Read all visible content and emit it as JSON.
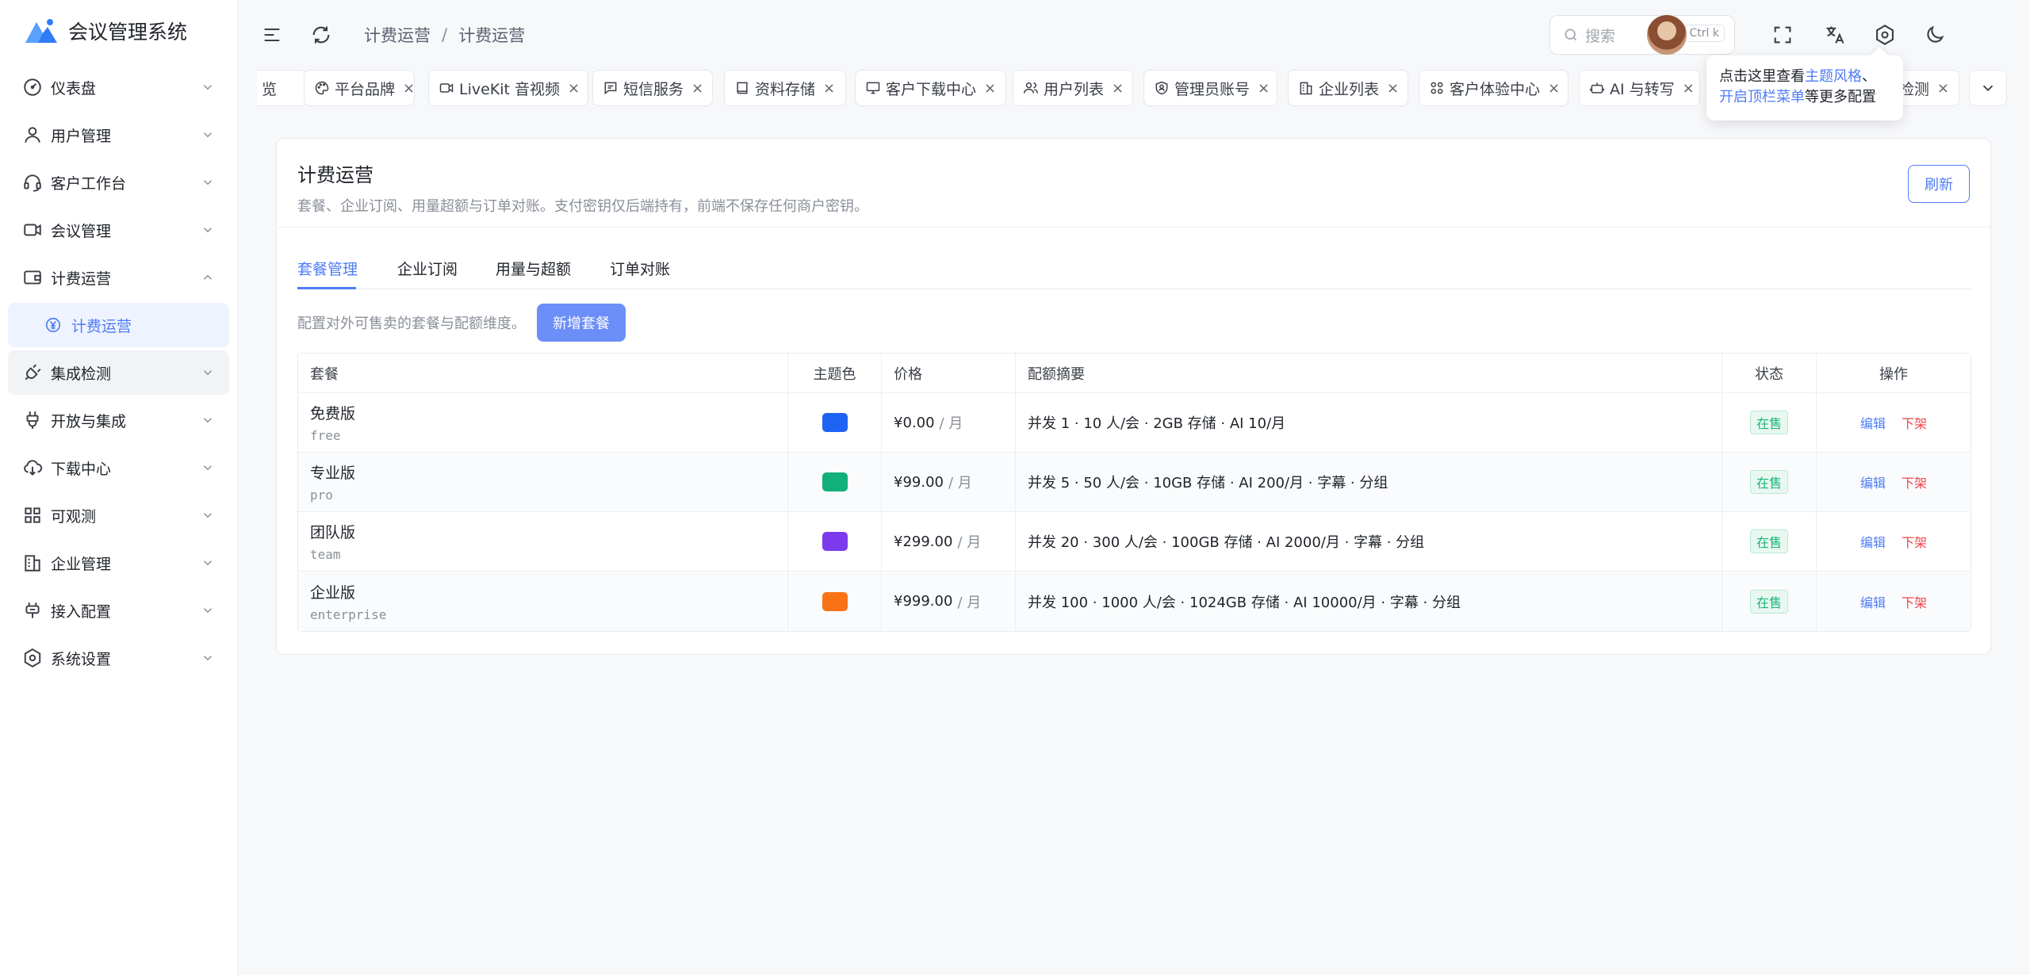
{
  "app": {
    "title": "会议管理系统"
  },
  "sidebar": {
    "items": [
      {
        "label": "仪表盘",
        "icon": "gauge-icon",
        "expanded": false
      },
      {
        "label": "用户管理",
        "icon": "user-icon",
        "expanded": false
      },
      {
        "label": "客户工作台",
        "icon": "headset-icon",
        "expanded": false
      },
      {
        "label": "会议管理",
        "icon": "video-icon",
        "expanded": false
      },
      {
        "label": "计费运营",
        "icon": "wallet-icon",
        "expanded": true,
        "children": [
          {
            "label": "计费运营",
            "icon": "yen-circle-icon",
            "active": true
          }
        ]
      },
      {
        "label": "集成检测",
        "icon": "plug-check-icon",
        "expanded": false,
        "hover": true
      },
      {
        "label": "开放与集成",
        "icon": "plug-icon",
        "expanded": false
      },
      {
        "label": "下载中心",
        "icon": "cloud-download-icon",
        "expanded": false
      },
      {
        "label": "可观测",
        "icon": "grid-icon",
        "expanded": false
      },
      {
        "label": "企业管理",
        "icon": "building-icon",
        "expanded": false
      },
      {
        "label": "接入配置",
        "icon": "plug-in-icon",
        "expanded": false
      },
      {
        "label": "系统设置",
        "icon": "gear-icon",
        "expanded": false
      }
    ]
  },
  "header": {
    "breadcrumb": [
      "计费运营",
      "计费运营"
    ],
    "breadcrumb_sep": "/",
    "search_placeholder": "搜索",
    "search_shortcut": "Ctrl k"
  },
  "tabs": [
    {
      "label": "览",
      "icon": null
    },
    {
      "label": "平台品牌",
      "icon": "palette-icon"
    },
    {
      "label": "LiveKit 音视频",
      "icon": "video-icon"
    },
    {
      "label": "短信服务",
      "icon": "message-icon"
    },
    {
      "label": "资料存储",
      "icon": "book-icon"
    },
    {
      "label": "客户下载中心",
      "icon": "monitor-icon"
    },
    {
      "label": "用户列表",
      "icon": "users-icon"
    },
    {
      "label": "管理员账号",
      "icon": "shield-user-icon"
    },
    {
      "label": "企业列表",
      "icon": "building-icon"
    },
    {
      "label": "客户体验中心",
      "icon": "apps-icon"
    },
    {
      "label": "AI 与转写",
      "icon": "robot-icon"
    },
    {
      "label": "检测",
      "icon": null
    }
  ],
  "tab_close": "×",
  "tooltip": {
    "prefix": "点击这里查看",
    "link1": "主题风格",
    "sep": "、",
    "link2": "开启顶栏菜单",
    "suffix": "等更多配置"
  },
  "page": {
    "title": "计费运营",
    "description": "套餐、企业订阅、用量超额与订单对账。支付密钥仅后端持有，前端不保存任何商户密钥。",
    "refresh_label": "刷新",
    "tabs": [
      "套餐管理",
      "企业订阅",
      "用量与超额",
      "订单对账"
    ],
    "active_tab": 0,
    "toolbar_text": "配置对外可售卖的套餐与配额维度。",
    "add_label": "新增套餐"
  },
  "table": {
    "headers": [
      "套餐",
      "主题色",
      "价格",
      "配额摘要",
      "状态",
      "操作"
    ],
    "rows": [
      {
        "name": "免费版",
        "code": "free",
        "color": "#1f63f5",
        "price": "¥0.00",
        "unit": "/ 月",
        "quota": "并发 1 · 10 人/会 · 2GB 存储 · AI 10/月",
        "status": "在售",
        "edit": "编辑",
        "off": "下架"
      },
      {
        "name": "专业版",
        "code": "pro",
        "color": "#13b07a",
        "price": "¥99.00",
        "unit": "/ 月",
        "quota": "并发 5 · 50 人/会 · 10GB 存储 · AI 200/月 · 字幕 · 分组",
        "status": "在售",
        "edit": "编辑",
        "off": "下架"
      },
      {
        "name": "团队版",
        "code": "team",
        "color": "#7c3aed",
        "price": "¥299.00",
        "unit": "/ 月",
        "quota": "并发 20 · 300 人/会 · 100GB 存储 · AI 2000/月 · 字幕 · 分组",
        "status": "在售",
        "edit": "编辑",
        "off": "下架"
      },
      {
        "name": "企业版",
        "code": "enterprise",
        "color": "#f97316",
        "price": "¥999.00",
        "unit": "/ 月",
        "quota": "并发 100 · 1000 人/会 · 1024GB 存储 · AI 10000/月 · 字幕 · 分组",
        "status": "在售",
        "edit": "编辑",
        "off": "下架"
      }
    ]
  },
  "colors": {
    "accent": "#4e7cf6",
    "success": "#19b67a",
    "danger": "#f0454b"
  }
}
